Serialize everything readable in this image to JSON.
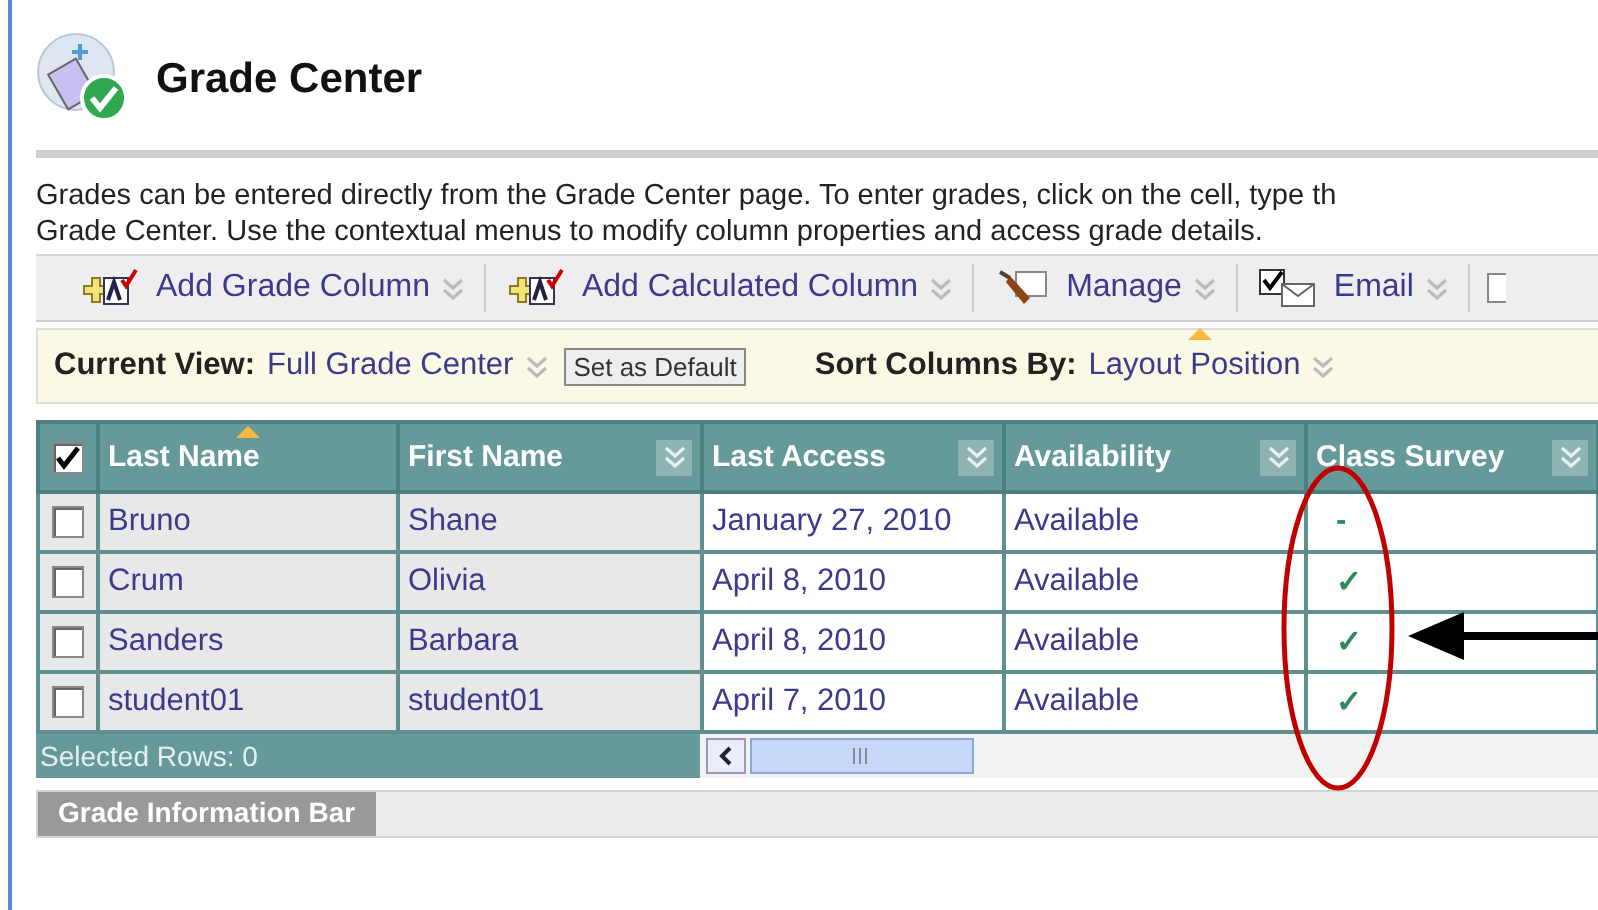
{
  "page": {
    "title": "Grade Center"
  },
  "description": [
    "Grades can be entered directly from the Grade Center page. To enter grades, click on the cell, type th",
    "Grade Center. Use the contextual menus to modify column properties and access grade details."
  ],
  "toolbar": [
    {
      "kind": "add",
      "label": "Add Grade Column"
    },
    {
      "kind": "add",
      "label": "Add Calculated Column"
    },
    {
      "kind": "manage",
      "label": "Manage"
    },
    {
      "kind": "email",
      "label": "Email"
    }
  ],
  "view_bar": {
    "current_view_label": "Current View:",
    "current_view": "Full Grade Center",
    "set_default_button": "Set as Default",
    "sort_label": "Sort Columns By:",
    "sort_value": "Layout Position"
  },
  "table": {
    "select_all_checked": true,
    "columns": [
      {
        "label": "Last Name",
        "sorted": true,
        "menu": false
      },
      {
        "label": "First Name",
        "sorted": false,
        "menu": true
      },
      {
        "label": "Last Access",
        "sorted": false,
        "menu": true
      },
      {
        "label": "Availability",
        "sorted": false,
        "menu": true
      },
      {
        "label": "Class Survey",
        "sorted": false,
        "menu": true
      }
    ],
    "rows": [
      {
        "checked": false,
        "cells": [
          "Bruno",
          "Shane",
          "January 27, 2010",
          "Available",
          "-"
        ]
      },
      {
        "checked": false,
        "cells": [
          "Crum",
          "Olivia",
          "April 8, 2010",
          "Available",
          "✓"
        ]
      },
      {
        "checked": false,
        "cells": [
          "Sanders",
          "Barbara",
          "April 8, 2010",
          "Available",
          "✓"
        ]
      },
      {
        "checked": false,
        "cells": [
          "student01",
          "student01",
          "April 7, 2010",
          "Available",
          "✓"
        ]
      }
    ],
    "footer": "Selected Rows: 0"
  },
  "info_bar": {
    "label": "Grade Information Bar"
  }
}
